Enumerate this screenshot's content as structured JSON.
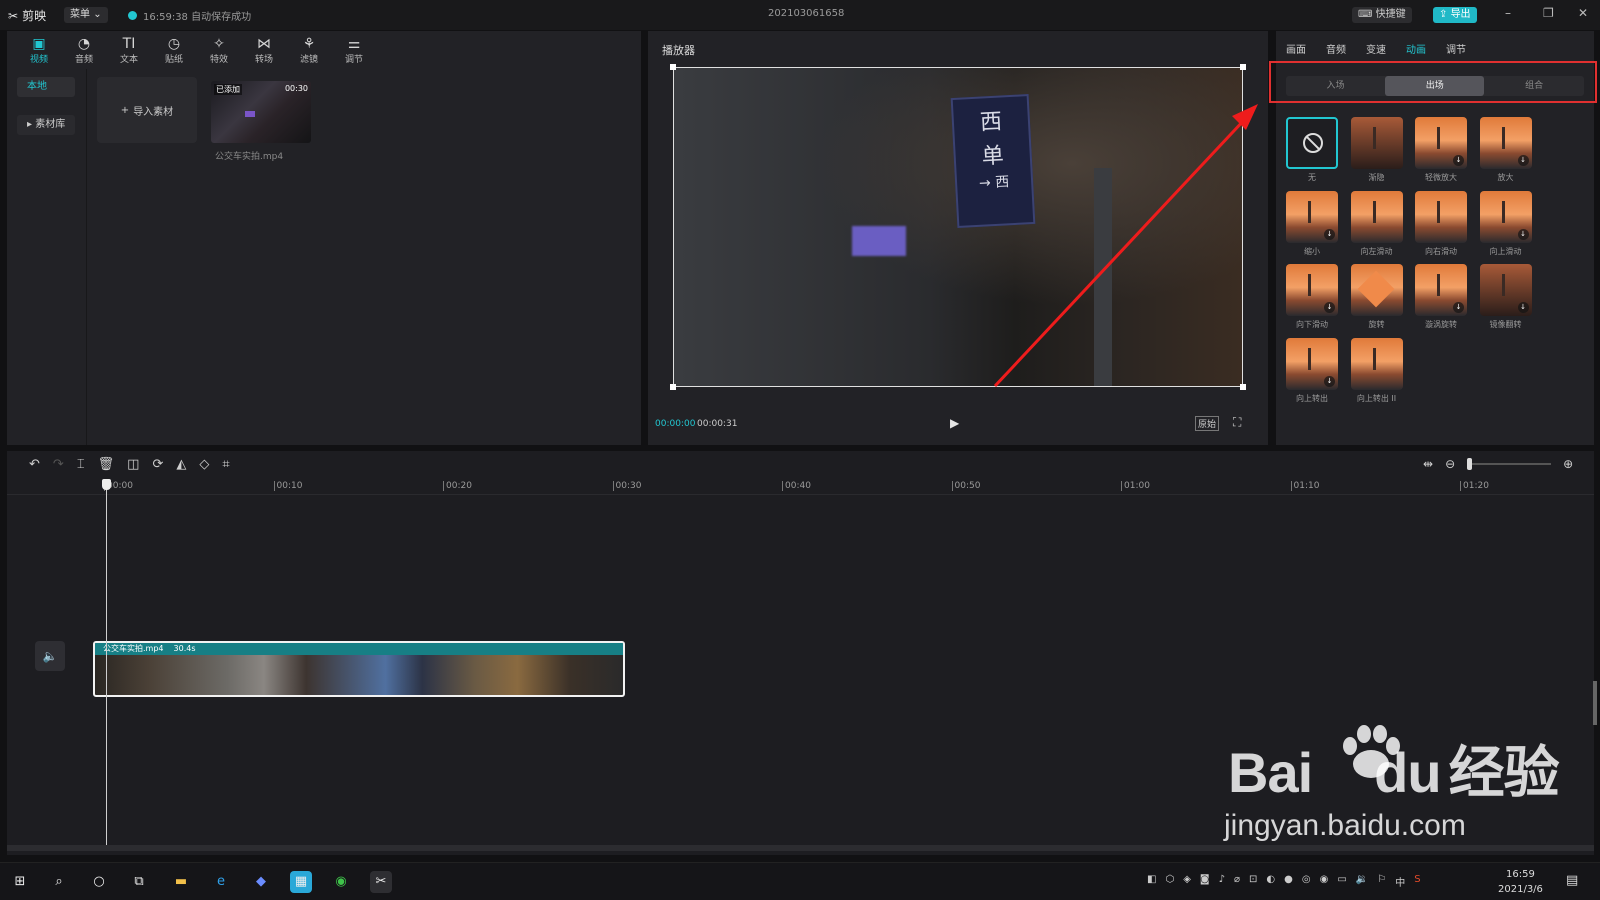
{
  "app": {
    "name": "剪映",
    "menu_label": "菜单",
    "autosave_text": "16:59:38 自动保存成功",
    "project_name": "202103061658",
    "shortcut_label": "快捷键",
    "export_label": "导出"
  },
  "media": {
    "tabs": [
      {
        "label": "视频",
        "icon": "▣"
      },
      {
        "label": "音频",
        "icon": "◔"
      },
      {
        "label": "文本",
        "icon": "TI"
      },
      {
        "label": "贴纸",
        "icon": "◷"
      },
      {
        "label": "特效",
        "icon": "✧"
      },
      {
        "label": "转场",
        "icon": "⋈"
      },
      {
        "label": "滤镜",
        "icon": "⚘"
      },
      {
        "label": "调节",
        "icon": "⚌"
      }
    ],
    "side_local": "本地",
    "side_library": "素材库",
    "import_label": "导入素材",
    "clip": {
      "tag": "已添加",
      "duration": "00:30",
      "filename": "公交车实拍.mp4"
    }
  },
  "player": {
    "title": "播放器",
    "current_time": "00:00:00",
    "total_time": "00:00:31",
    "original_label": "原始",
    "sign_text": "西单",
    "sign_sub": "西"
  },
  "props": {
    "tabs": [
      "画面",
      "音频",
      "变速",
      "动画",
      "调节"
    ],
    "active_tab": "动画",
    "segments": [
      "入场",
      "出场",
      "组合"
    ],
    "active_segment": "出场",
    "animations": [
      {
        "label": "无",
        "kind": "none",
        "download": false
      },
      {
        "label": "渐隐",
        "kind": "dark",
        "download": false
      },
      {
        "label": "轻微放大",
        "kind": "std",
        "download": true
      },
      {
        "label": "放大",
        "kind": "std",
        "download": true
      },
      {
        "label": "缩小",
        "kind": "std",
        "download": true
      },
      {
        "label": "向左滑动",
        "kind": "std",
        "download": false
      },
      {
        "label": "向右滑动",
        "kind": "std",
        "download": false
      },
      {
        "label": "向上滑动",
        "kind": "std",
        "download": true
      },
      {
        "label": "向下滑动",
        "kind": "std",
        "download": true
      },
      {
        "label": "旋转",
        "kind": "rot",
        "download": false
      },
      {
        "label": "漩涡旋转",
        "kind": "std",
        "download": true
      },
      {
        "label": "镜像翻转",
        "kind": "dark",
        "download": true
      },
      {
        "label": "向上转出",
        "kind": "std",
        "download": true
      },
      {
        "label": "向上转出 II",
        "kind": "std",
        "download": false
      }
    ]
  },
  "timeline": {
    "ticks": [
      "00:00",
      "00:10",
      "00:20",
      "00:30",
      "00:40",
      "00:50",
      "01:00",
      "01:10",
      "01:20"
    ],
    "clip_name": "公交车实拍.mp4",
    "clip_duration": "30.4s"
  },
  "watermark": {
    "brand": "Bai",
    "brand2": "du",
    "cn": "经验",
    "url": "jingyan.baidu.com"
  },
  "taskbar": {
    "time": "16:59",
    "date": "2021/3/6",
    "ime": "中"
  },
  "colors": {
    "accent": "#22c7d1",
    "highlight_box": "#e03030"
  }
}
